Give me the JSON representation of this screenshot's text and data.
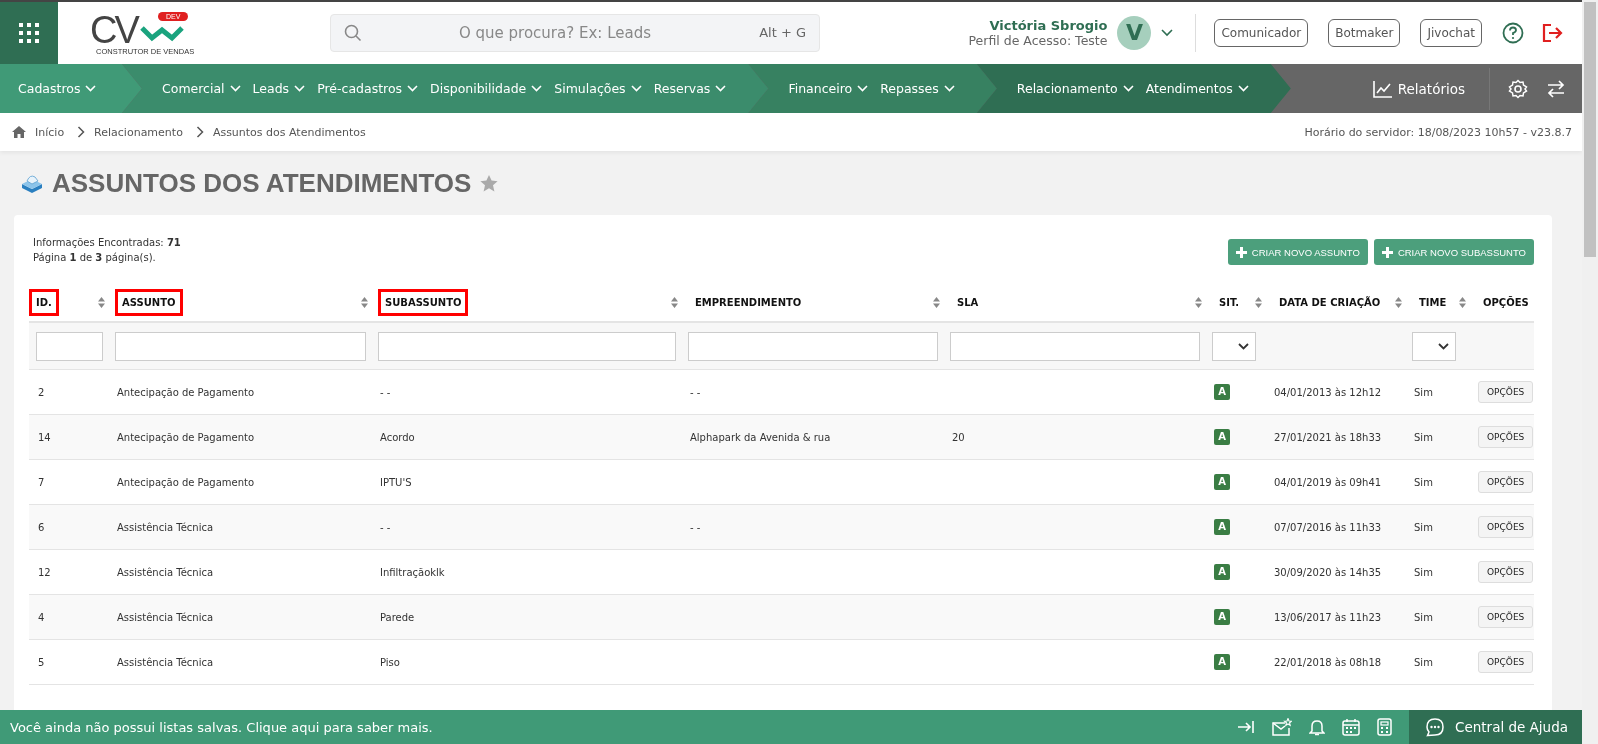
{
  "header": {
    "logo": {
      "text": "CV",
      "badge": "DEV",
      "tagline": "CONSTRUTOR DE VENDAS"
    },
    "search": {
      "placeholder": "O que procura? Ex: Leads",
      "shortcut": "Alt + G"
    },
    "user": {
      "name": "Victória Sbrogio",
      "profile": "Perfil de Acesso: Teste",
      "initial": "V"
    },
    "buttons": [
      "Comunicador",
      "Botmaker",
      "Jivochat"
    ]
  },
  "nav": {
    "groups": [
      {
        "items": [
          "Cadastros"
        ]
      },
      {
        "items": [
          "Comercial",
          "Leads",
          "Pré-cadastros",
          "Disponibilidade",
          "Simulações",
          "Reservas"
        ]
      },
      {
        "items": [
          "Financeiro",
          "Repasses"
        ]
      },
      {
        "items": [
          "Relacionamento",
          "Atendimentos"
        ]
      }
    ],
    "reports": "Relatórios"
  },
  "breadcrumb": {
    "items": [
      "Início",
      "Relacionamento",
      "Assuntos dos Atendimentos"
    ],
    "server_time": "Horário do servidor: 18/08/2023 10h57 - v23.8.7"
  },
  "page": {
    "title": "ASSUNTOS DOS ATENDIMENTOS",
    "favorite": false
  },
  "summary": {
    "found": "Informações Encontradas: **71**",
    "pages": "Página **1** de **3** página(s)."
  },
  "actions": [
    "CRIAR NOVO ASSUNTO",
    "CRIAR NOVO SUBASSUNTO"
  ],
  "table": {
    "columns": [
      {
        "label": "ID.",
        "sortable": true,
        "highlighted": true,
        "kind": "text"
      },
      {
        "label": "ASSUNTO",
        "sortable": true,
        "highlighted": true,
        "kind": "text"
      },
      {
        "label": "SUBASSUNTO",
        "sortable": true,
        "highlighted": true,
        "kind": "text"
      },
      {
        "label": "EMPREENDIMENTO",
        "sortable": true,
        "highlighted": false,
        "kind": "text"
      },
      {
        "label": "SLA",
        "sortable": true,
        "highlighted": false,
        "kind": "text"
      },
      {
        "label": "SIT.",
        "sortable": true,
        "highlighted": false,
        "kind": "select"
      },
      {
        "label": "DATA DE CRIAÇÃO",
        "sortable": true,
        "highlighted": false,
        "kind": "plain"
      },
      {
        "label": "TIME",
        "sortable": true,
        "highlighted": false,
        "kind": "select"
      },
      {
        "label": "OPÇÕES",
        "sortable": false,
        "highlighted": false,
        "kind": "plain"
      }
    ],
    "rows": [
      {
        "cells": [
          "2",
          "Antecipação de Pagamento",
          "- -",
          "- -",
          ""
        ],
        "status": "A",
        "created": "04/01/2013 às 12h12",
        "time": "Sim",
        "options": "OPÇÕES"
      },
      {
        "cells": [
          "14",
          "Antecipação de Pagamento",
          "Acordo",
          "Alphapark da Avenida & rua",
          "20"
        ],
        "status": "A",
        "created": "27/01/2021 às 18h33",
        "time": "Sim",
        "options": "OPÇÕES"
      },
      {
        "cells": [
          "7",
          "Antecipação de Pagamento",
          "IPTU'S",
          "",
          ""
        ],
        "status": "A",
        "created": "04/01/2019 às 09h41",
        "time": "Sim",
        "options": "OPÇÕES"
      },
      {
        "cells": [
          "6",
          "Assistência Técnica",
          "- -",
          "- -",
          ""
        ],
        "status": "A",
        "created": "07/07/2016 às 11h33",
        "time": "Sim",
        "options": "OPÇÕES"
      },
      {
        "cells": [
          "12",
          "Assistência Técnica",
          "Infiltraçãoklk",
          "",
          ""
        ],
        "status": "A",
        "created": "30/09/2020 às 14h35",
        "time": "Sim",
        "options": "OPÇÕES"
      },
      {
        "cells": [
          "4",
          "Assistência Técnica",
          "Parede",
          "",
          ""
        ],
        "status": "A",
        "created": "13/06/2017 às 11h23",
        "time": "Sim",
        "options": "OPÇÕES"
      },
      {
        "cells": [
          "5",
          "Assistência Técnica",
          "Piso",
          "",
          ""
        ],
        "status": "A",
        "created": "22/01/2018 às 08h18",
        "time": "Sim",
        "options": "OPÇÕES"
      }
    ]
  },
  "bottom_bar": {
    "message": "Você ainda não possui listas salvas. Clique aqui para saber mais.",
    "help": "Central de Ajuda"
  }
}
